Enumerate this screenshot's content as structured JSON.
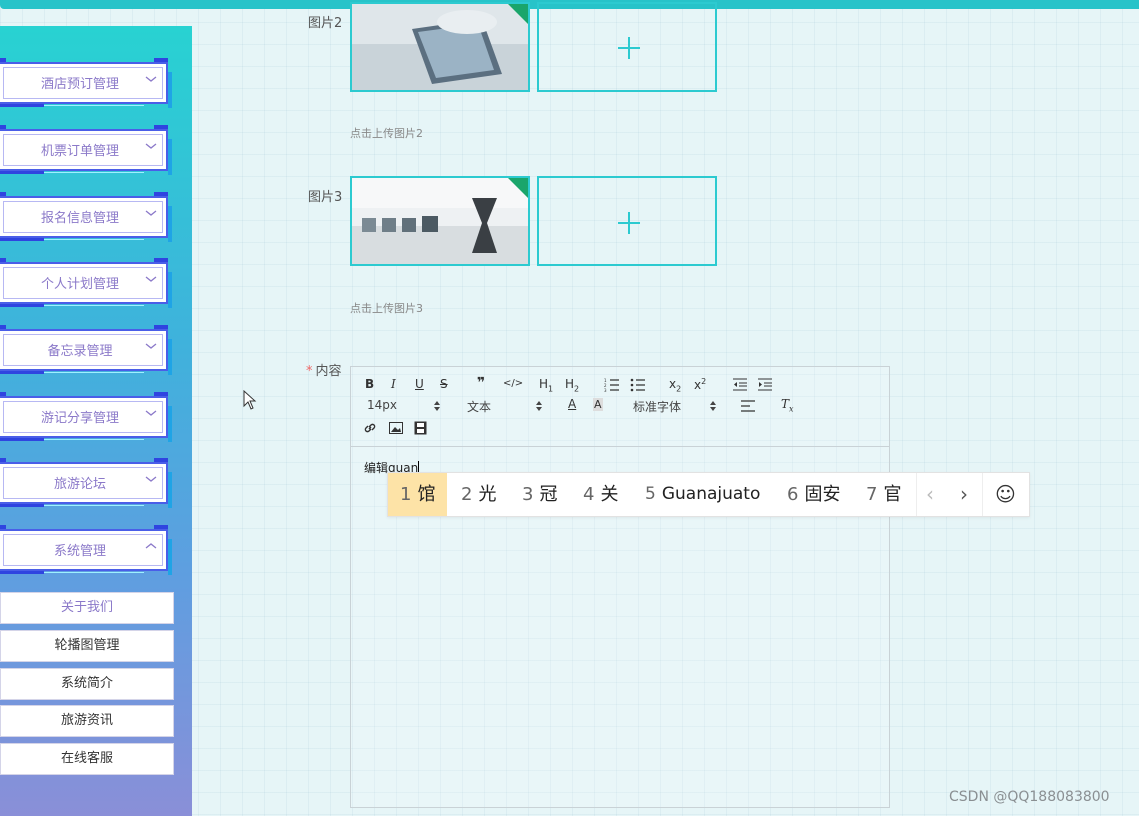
{
  "sidebar": {
    "menu": [
      {
        "label": "酒店预订管理",
        "chevron": "chevron-down-icon"
      },
      {
        "label": "机票订单管理",
        "chevron": "chevron-down-icon"
      },
      {
        "label": "报名信息管理",
        "chevron": "chevron-down-icon"
      },
      {
        "label": "个人计划管理",
        "chevron": "chevron-down-icon"
      },
      {
        "label": "备忘录管理",
        "chevron": "chevron-down-icon"
      },
      {
        "label": "游记分享管理",
        "chevron": "chevron-down-icon"
      },
      {
        "label": "旅游论坛",
        "chevron": "chevron-down-icon"
      },
      {
        "label": "系统管理",
        "chevron": "chevron-up-icon"
      }
    ],
    "submenu": [
      "关于我们",
      "轮播图管理",
      "系统简介",
      "旅游资讯",
      "在线客服"
    ]
  },
  "form": {
    "image2": {
      "label": "图片2",
      "hint": "点击上传图片2"
    },
    "image3": {
      "label": "图片3",
      "hint": "点击上传图片3"
    },
    "content": {
      "required_mark": "*",
      "label": "内容"
    }
  },
  "editor": {
    "toolbar": {
      "row1": [
        "B",
        "I",
        "U",
        "S",
        "❞",
        "</>",
        "H1",
        "H2",
        "ordered-list",
        "bullet-list",
        "X2sub",
        "X2sup",
        "outdent",
        "indent"
      ],
      "font_size": "14px",
      "text_style": "文本",
      "font_family": "标准字体"
    },
    "text": "编辑guan"
  },
  "ime": {
    "candidates": [
      {
        "num": "1",
        "text": "馆"
      },
      {
        "num": "2",
        "text": "光"
      },
      {
        "num": "3",
        "text": "冠"
      },
      {
        "num": "4",
        "text": "关"
      },
      {
        "num": "5",
        "text": "Guanajuato"
      },
      {
        "num": "6",
        "text": "固安"
      },
      {
        "num": "7",
        "text": "官"
      }
    ],
    "prev": "‹",
    "next": "›",
    "emoji": "☺"
  },
  "watermark": "CSDN @QQ188083800",
  "colors": {
    "accent": "#2ccad0",
    "sidebar_top": "#28d2d2",
    "sidebar_bottom": "#8a8fd8",
    "menu_text": "#8b79c9",
    "ime_highlight": "#fde3a7"
  }
}
